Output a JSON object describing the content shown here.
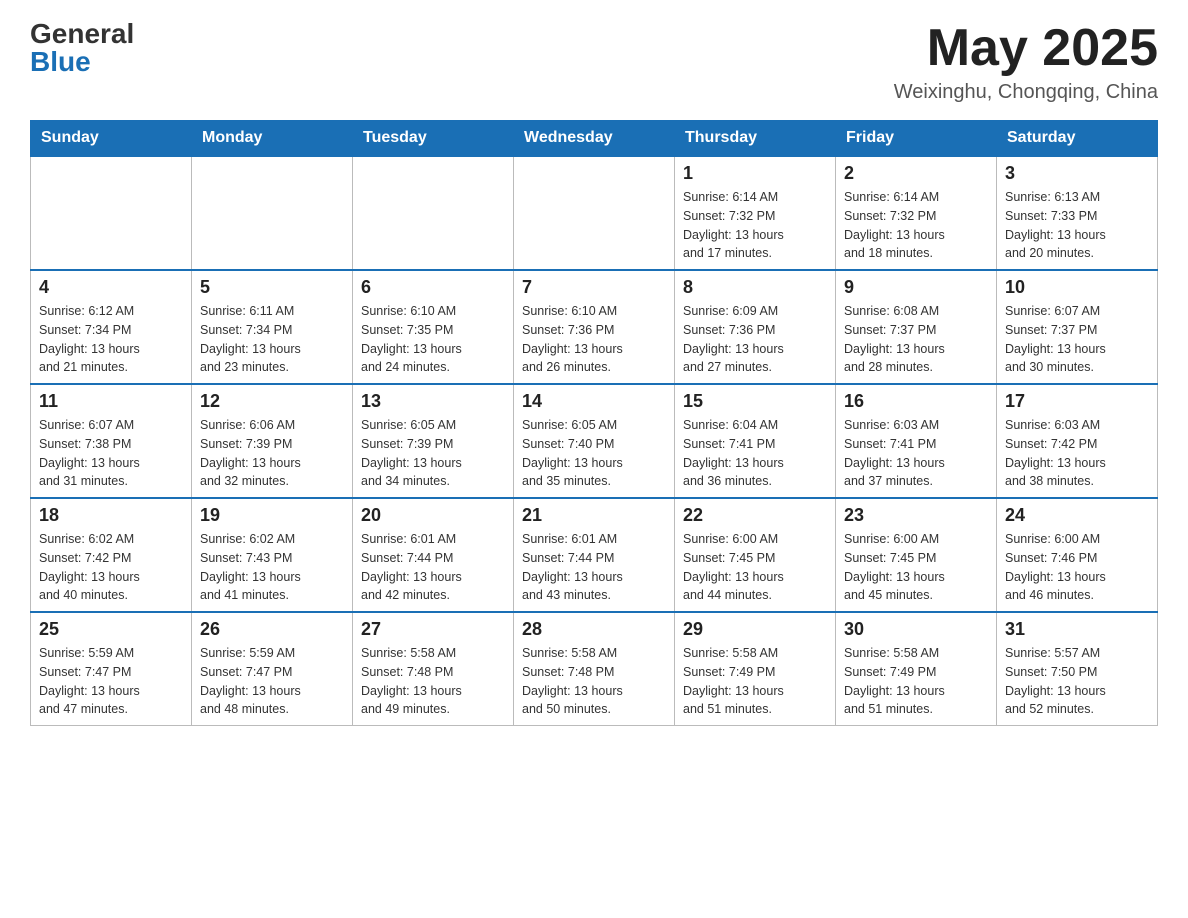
{
  "header": {
    "logo_general": "General",
    "logo_blue": "Blue",
    "month_year": "May 2025",
    "location": "Weixinghu, Chongqing, China"
  },
  "weekdays": [
    "Sunday",
    "Monday",
    "Tuesday",
    "Wednesday",
    "Thursday",
    "Friday",
    "Saturday"
  ],
  "weeks": [
    [
      {
        "day": "",
        "info": ""
      },
      {
        "day": "",
        "info": ""
      },
      {
        "day": "",
        "info": ""
      },
      {
        "day": "",
        "info": ""
      },
      {
        "day": "1",
        "info": "Sunrise: 6:14 AM\nSunset: 7:32 PM\nDaylight: 13 hours\nand 17 minutes."
      },
      {
        "day": "2",
        "info": "Sunrise: 6:14 AM\nSunset: 7:32 PM\nDaylight: 13 hours\nand 18 minutes."
      },
      {
        "day": "3",
        "info": "Sunrise: 6:13 AM\nSunset: 7:33 PM\nDaylight: 13 hours\nand 20 minutes."
      }
    ],
    [
      {
        "day": "4",
        "info": "Sunrise: 6:12 AM\nSunset: 7:34 PM\nDaylight: 13 hours\nand 21 minutes."
      },
      {
        "day": "5",
        "info": "Sunrise: 6:11 AM\nSunset: 7:34 PM\nDaylight: 13 hours\nand 23 minutes."
      },
      {
        "day": "6",
        "info": "Sunrise: 6:10 AM\nSunset: 7:35 PM\nDaylight: 13 hours\nand 24 minutes."
      },
      {
        "day": "7",
        "info": "Sunrise: 6:10 AM\nSunset: 7:36 PM\nDaylight: 13 hours\nand 26 minutes."
      },
      {
        "day": "8",
        "info": "Sunrise: 6:09 AM\nSunset: 7:36 PM\nDaylight: 13 hours\nand 27 minutes."
      },
      {
        "day": "9",
        "info": "Sunrise: 6:08 AM\nSunset: 7:37 PM\nDaylight: 13 hours\nand 28 minutes."
      },
      {
        "day": "10",
        "info": "Sunrise: 6:07 AM\nSunset: 7:37 PM\nDaylight: 13 hours\nand 30 minutes."
      }
    ],
    [
      {
        "day": "11",
        "info": "Sunrise: 6:07 AM\nSunset: 7:38 PM\nDaylight: 13 hours\nand 31 minutes."
      },
      {
        "day": "12",
        "info": "Sunrise: 6:06 AM\nSunset: 7:39 PM\nDaylight: 13 hours\nand 32 minutes."
      },
      {
        "day": "13",
        "info": "Sunrise: 6:05 AM\nSunset: 7:39 PM\nDaylight: 13 hours\nand 34 minutes."
      },
      {
        "day": "14",
        "info": "Sunrise: 6:05 AM\nSunset: 7:40 PM\nDaylight: 13 hours\nand 35 minutes."
      },
      {
        "day": "15",
        "info": "Sunrise: 6:04 AM\nSunset: 7:41 PM\nDaylight: 13 hours\nand 36 minutes."
      },
      {
        "day": "16",
        "info": "Sunrise: 6:03 AM\nSunset: 7:41 PM\nDaylight: 13 hours\nand 37 minutes."
      },
      {
        "day": "17",
        "info": "Sunrise: 6:03 AM\nSunset: 7:42 PM\nDaylight: 13 hours\nand 38 minutes."
      }
    ],
    [
      {
        "day": "18",
        "info": "Sunrise: 6:02 AM\nSunset: 7:42 PM\nDaylight: 13 hours\nand 40 minutes."
      },
      {
        "day": "19",
        "info": "Sunrise: 6:02 AM\nSunset: 7:43 PM\nDaylight: 13 hours\nand 41 minutes."
      },
      {
        "day": "20",
        "info": "Sunrise: 6:01 AM\nSunset: 7:44 PM\nDaylight: 13 hours\nand 42 minutes."
      },
      {
        "day": "21",
        "info": "Sunrise: 6:01 AM\nSunset: 7:44 PM\nDaylight: 13 hours\nand 43 minutes."
      },
      {
        "day": "22",
        "info": "Sunrise: 6:00 AM\nSunset: 7:45 PM\nDaylight: 13 hours\nand 44 minutes."
      },
      {
        "day": "23",
        "info": "Sunrise: 6:00 AM\nSunset: 7:45 PM\nDaylight: 13 hours\nand 45 minutes."
      },
      {
        "day": "24",
        "info": "Sunrise: 6:00 AM\nSunset: 7:46 PM\nDaylight: 13 hours\nand 46 minutes."
      }
    ],
    [
      {
        "day": "25",
        "info": "Sunrise: 5:59 AM\nSunset: 7:47 PM\nDaylight: 13 hours\nand 47 minutes."
      },
      {
        "day": "26",
        "info": "Sunrise: 5:59 AM\nSunset: 7:47 PM\nDaylight: 13 hours\nand 48 minutes."
      },
      {
        "day": "27",
        "info": "Sunrise: 5:58 AM\nSunset: 7:48 PM\nDaylight: 13 hours\nand 49 minutes."
      },
      {
        "day": "28",
        "info": "Sunrise: 5:58 AM\nSunset: 7:48 PM\nDaylight: 13 hours\nand 50 minutes."
      },
      {
        "day": "29",
        "info": "Sunrise: 5:58 AM\nSunset: 7:49 PM\nDaylight: 13 hours\nand 51 minutes."
      },
      {
        "day": "30",
        "info": "Sunrise: 5:58 AM\nSunset: 7:49 PM\nDaylight: 13 hours\nand 51 minutes."
      },
      {
        "day": "31",
        "info": "Sunrise: 5:57 AM\nSunset: 7:50 PM\nDaylight: 13 hours\nand 52 minutes."
      }
    ]
  ]
}
